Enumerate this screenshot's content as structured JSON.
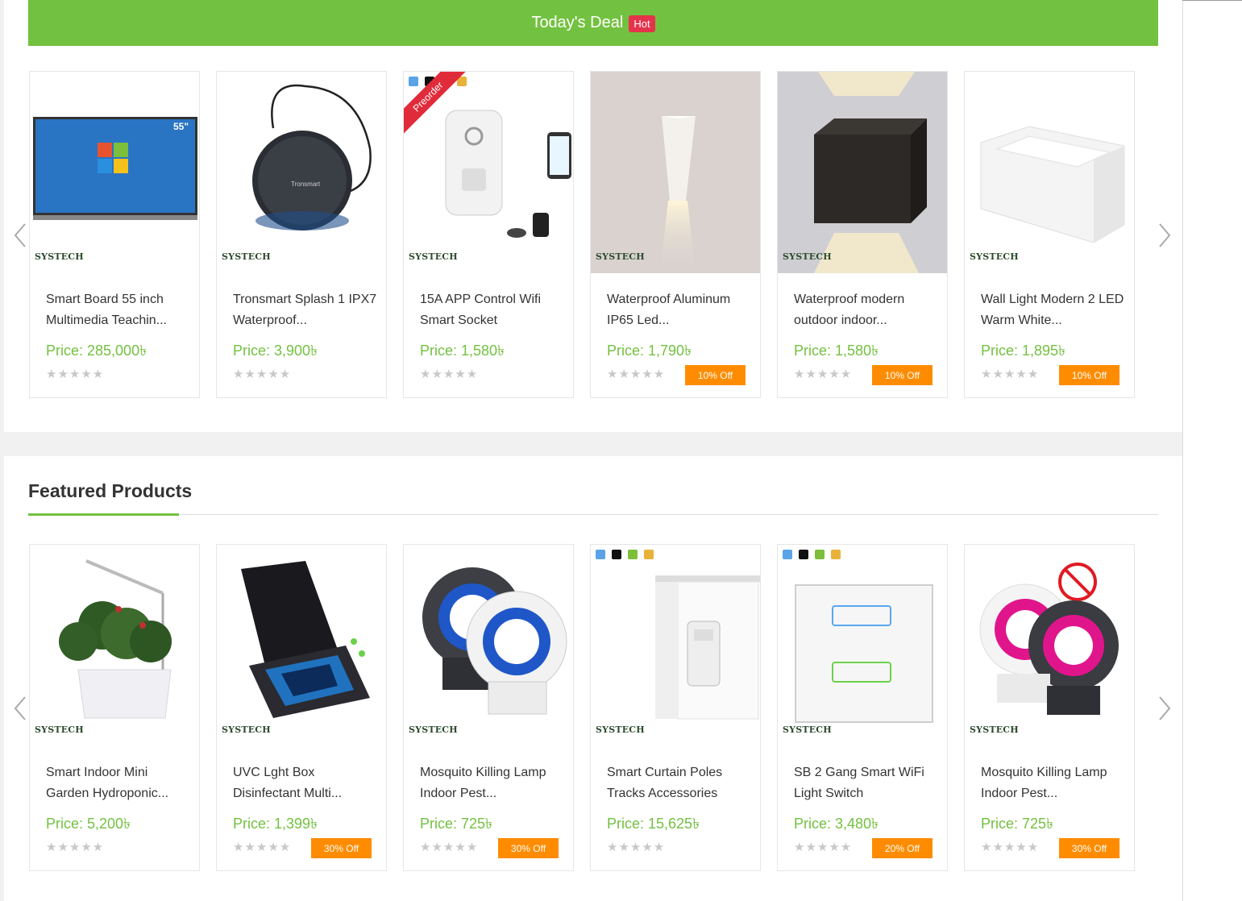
{
  "todays_deal": {
    "title": "Today's Deal",
    "badge": "Hot",
    "products": [
      {
        "name": "Smart Board 55 inch Multimedia Teachin...",
        "price": "Price: 285,000৳",
        "discount": "",
        "rating": 0,
        "brand": "SYSTECH"
      },
      {
        "name": "Tronsmart Splash 1 IPX7 Waterproof...",
        "price": "Price: 3,900৳",
        "discount": "",
        "rating": 0,
        "brand": "SYSTECH"
      },
      {
        "name": "15A APP Control Wifi Smart Socket",
        "price": "Price: 1,580৳",
        "discount": "",
        "rating": 0,
        "brand": "SYSTECH",
        "ribbon": "Preorder"
      },
      {
        "name": "Waterproof Aluminum IP65 Led...",
        "price": "Price: 1,790৳",
        "discount": "10% Off",
        "rating": 0,
        "brand": "SYSTECH"
      },
      {
        "name": "Waterproof modern outdoor indoor...",
        "price": "Price: 1,580৳",
        "discount": "10% Off",
        "rating": 0,
        "brand": "SYSTECH"
      },
      {
        "name": "Wall Light Modern 2 LED Warm White...",
        "price": "Price: 1,895৳",
        "discount": "10% Off",
        "rating": 0,
        "brand": "SYSTECH"
      }
    ]
  },
  "featured": {
    "title": "Featured Products",
    "products": [
      {
        "name": "Smart Indoor Mini Garden Hydroponic...",
        "price": "Price: 5,200৳",
        "discount": "",
        "rating": 0,
        "brand": "SYSTECH"
      },
      {
        "name": "UVC Lght Box Disinfectant Multi...",
        "price": "Price: 1,399৳",
        "discount": "30% Off",
        "rating": 0,
        "brand": "SYSTECH"
      },
      {
        "name": "Mosquito Killing Lamp Indoor Pest...",
        "price": "Price: 725৳",
        "discount": "30% Off",
        "rating": 0,
        "brand": "SYSTECH"
      },
      {
        "name": "Smart Curtain Poles Tracks Accessories",
        "price": "Price: 15,625৳",
        "discount": "",
        "rating": 0,
        "brand": "SYSTECH"
      },
      {
        "name": "SB 2 Gang Smart WiFi Light Switch",
        "price": "Price: 3,480৳",
        "discount": "20% Off",
        "rating": 0,
        "brand": "SYSTECH"
      },
      {
        "name": "Mosquito Killing Lamp Indoor Pest...",
        "price": "Price: 725৳",
        "discount": "30% Off",
        "rating": 0,
        "brand": "SYSTECH"
      }
    ]
  },
  "stars": "★★★★★",
  "colors": {
    "accent": "#73c140",
    "hot": "#e5334b",
    "discount": "#ff8c00"
  }
}
